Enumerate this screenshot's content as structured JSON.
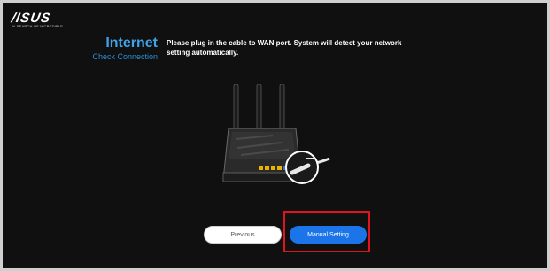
{
  "brand": {
    "logo_text": "/ISUS",
    "tagline": "IN SEARCH OF INCREDIBLE"
  },
  "step": {
    "title": "Internet",
    "subtitle": "Check Connection"
  },
  "instruction": "Please plug in the cable to WAN port. System will detect your network setting automatically.",
  "illustration": {
    "icon": "router-wan-cable-icon"
  },
  "buttons": {
    "previous_label": "Previous",
    "manual_setting_label": "Manual Setting"
  },
  "colors": {
    "background": "#101010",
    "accent_blue": "#1b75e8",
    "title_blue": "#3ea3e8",
    "highlight_red": "#e0141e"
  }
}
